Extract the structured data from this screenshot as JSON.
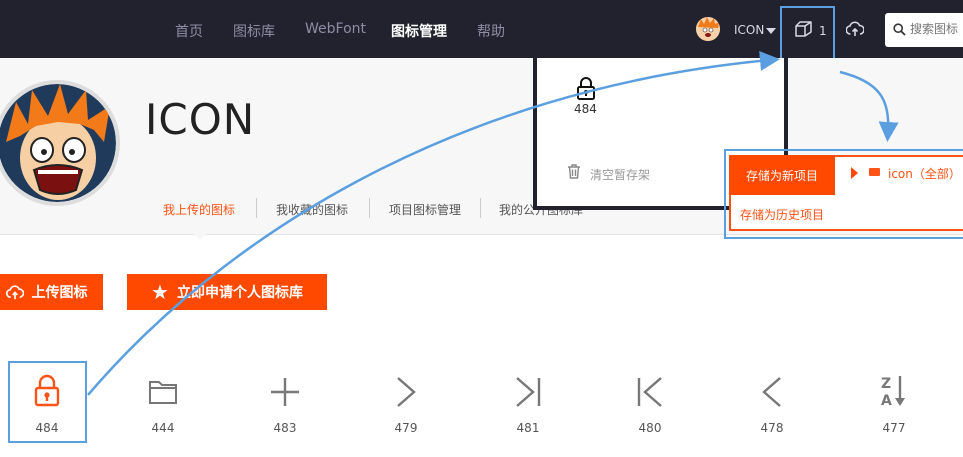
{
  "nav": {
    "items": [
      "首页",
      "图标库",
      "WebFont",
      "图标管理",
      "帮助"
    ],
    "active_index": 3
  },
  "user": {
    "name": "ICON"
  },
  "cart": {
    "count": "1"
  },
  "search": {
    "placeholder": "搜索图标"
  },
  "profile": {
    "name": "ICON",
    "tabs": [
      "我上传的图标",
      "我收藏的图标",
      "项目图标管理",
      "我的公开图标库"
    ],
    "active_tab": 0
  },
  "actions": {
    "upload": "上传图标",
    "apply": "立即申请个人图标库"
  },
  "icons": [
    {
      "icon": "lock-icon",
      "number": "484"
    },
    {
      "icon": "folder-icon",
      "number": "444"
    },
    {
      "icon": "plus-icon",
      "number": "483"
    },
    {
      "icon": "chevron-right-icon",
      "number": "479"
    },
    {
      "icon": "skip-end-icon",
      "number": "481"
    },
    {
      "icon": "skip-start-icon",
      "number": "480"
    },
    {
      "icon": "chevron-left-icon",
      "number": "478"
    },
    {
      "icon": "sort-za-icon",
      "number": "477"
    }
  ],
  "cart_panel": {
    "item_number": "484",
    "clear": "清空暂存架"
  },
  "save_menu": {
    "new": "存储为新项目",
    "history": "存储为历史项目",
    "project": "icon（全部）"
  },
  "colors": {
    "accent": "#ff4800",
    "nav_bg": "#22222e",
    "highlight": "#5b9fe0"
  }
}
